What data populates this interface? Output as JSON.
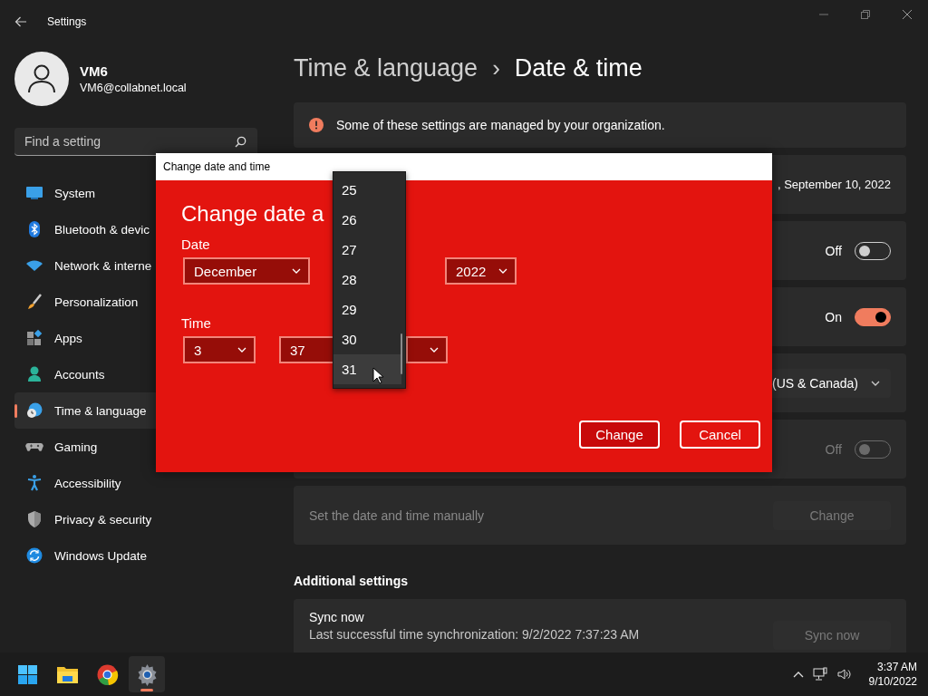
{
  "window": {
    "title": "Settings"
  },
  "profile": {
    "name": "VM6",
    "email": "VM6@collabnet.local"
  },
  "search": {
    "placeholder": "Find a setting"
  },
  "sidebar": {
    "items": [
      {
        "label": "System",
        "selected": false
      },
      {
        "label": "Bluetooth & devic",
        "selected": false
      },
      {
        "label": "Network & interne",
        "selected": false
      },
      {
        "label": "Personalization",
        "selected": false
      },
      {
        "label": "Apps",
        "selected": false
      },
      {
        "label": "Accounts",
        "selected": false
      },
      {
        "label": "Time & language",
        "selected": true
      },
      {
        "label": "Gaming",
        "selected": false
      },
      {
        "label": "Accessibility",
        "selected": false
      },
      {
        "label": "Privacy & security",
        "selected": false
      },
      {
        "label": "Windows Update",
        "selected": false
      }
    ]
  },
  "breadcrumb": {
    "parent": "Time & language",
    "separator": "›",
    "current": "Date & time"
  },
  "notice": "Some of these settings are managed by your organization.",
  "rows": [
    {
      "kind": "text",
      "value": ", September 10, 2022"
    },
    {
      "kind": "toggle",
      "state_label": "Off",
      "on": false,
      "disabled": false
    },
    {
      "kind": "toggle",
      "state_label": "On",
      "on": true,
      "disabled": false
    },
    {
      "kind": "dropdown",
      "value": "(US & Canada)"
    },
    {
      "kind": "toggle",
      "state_label": "Off",
      "on": false,
      "disabled": true
    },
    {
      "kind": "button",
      "label": "Set the date and time manually",
      "button": "Change",
      "disabled": true
    }
  ],
  "additional": {
    "heading": "Additional settings",
    "sync": {
      "title": "Sync now",
      "detail": "Last successful time synchronization: 9/2/2022 7:37:23 AM",
      "button": "Sync now",
      "disabled": true
    }
  },
  "dialog": {
    "title": "Change date and time",
    "heading": "Change date a",
    "date_label": "Date",
    "month": "December",
    "year": "2022",
    "time_label": "Time",
    "hour": "3",
    "minute": "37",
    "day_list": [
      {
        "label": "25",
        "selected": false
      },
      {
        "label": "26",
        "selected": false
      },
      {
        "label": "27",
        "selected": false
      },
      {
        "label": "28",
        "selected": false
      },
      {
        "label": "29",
        "selected": false
      },
      {
        "label": "30",
        "selected": false
      },
      {
        "label": "31",
        "selected": true
      }
    ],
    "buttons": [
      "Change",
      "Cancel"
    ]
  },
  "taskbar": {
    "apps": [
      {
        "selected": false
      },
      {
        "selected": false
      },
      {
        "selected": false
      },
      {
        "selected": true
      }
    ],
    "time": "3:37 AM",
    "date": "9/10/2022"
  }
}
